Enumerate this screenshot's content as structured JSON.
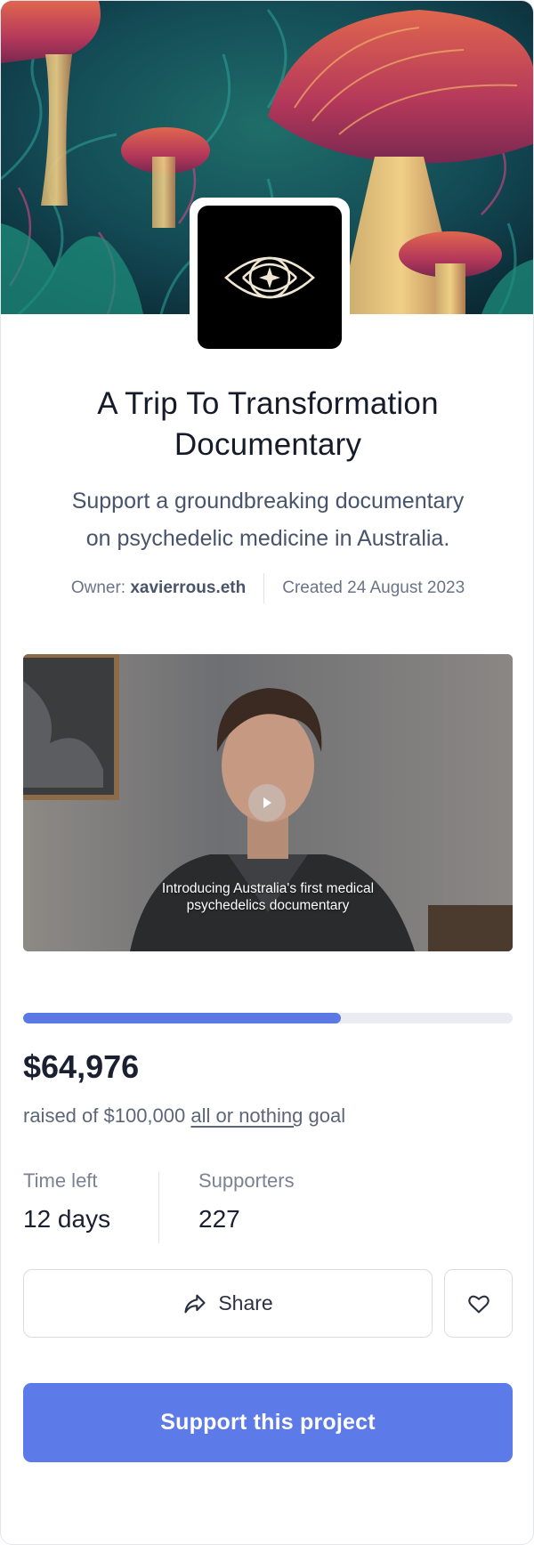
{
  "project": {
    "title_line1": "A Trip To Transformation",
    "title_line2": "Documentary",
    "subtitle_line1": "Support a groundbreaking documentary",
    "subtitle_line2": "on psychedelic medicine in Australia.",
    "owner_label": "Owner:",
    "owner_name": "xavierrous.eth",
    "created": "Created 24 August 2023"
  },
  "video": {
    "caption_line1": "Introducing Australia's first medical",
    "caption_line2": "psychedelics documentary",
    "play_icon": "play-icon"
  },
  "funding": {
    "progress": 0.6498,
    "amount": "$64,976",
    "goal_prefix": "raised of $100,000",
    "goal_link": "all or nothing",
    "goal_suffix": "goal"
  },
  "stats": {
    "time_left_label": "Time left",
    "time_left_value": "12 days",
    "supporters_label": "Supporters",
    "supporters_value": "227"
  },
  "actions": {
    "share_label": "Share",
    "share_icon": "share-icon",
    "favorite_icon": "heart-icon",
    "support_label": "Support this project"
  },
  "colors": {
    "accent": "#5c7ae8",
    "progress_fill": "#5a79e5",
    "progress_track": "#eaecf1",
    "text_primary": "#1b2031",
    "text_muted": "#5d6679"
  }
}
